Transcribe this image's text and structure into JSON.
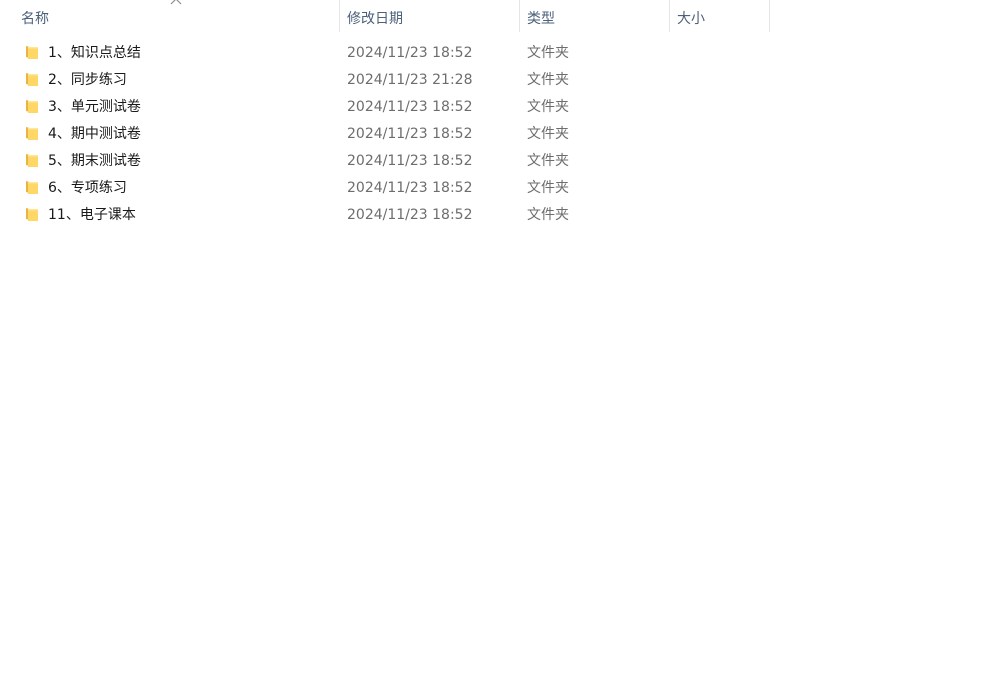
{
  "header": {
    "name_label": "名称",
    "date_label": "修改日期",
    "type_label": "类型",
    "size_label": "大小",
    "sort_icon": "chevron-up-icon"
  },
  "rows": [
    {
      "name": "1、知识点总结",
      "date": "2024/11/23 18:52",
      "type": "文件夹",
      "size": ""
    },
    {
      "name": "2、同步练习",
      "date": "2024/11/23 21:28",
      "type": "文件夹",
      "size": ""
    },
    {
      "name": "3、单元测试卷",
      "date": "2024/11/23 18:52",
      "type": "文件夹",
      "size": ""
    },
    {
      "name": "4、期中测试卷",
      "date": "2024/11/23 18:52",
      "type": "文件夹",
      "size": ""
    },
    {
      "name": "5、期末测试卷",
      "date": "2024/11/23 18:52",
      "type": "文件夹",
      "size": ""
    },
    {
      "name": "6、专项练习",
      "date": "2024/11/23 18:52",
      "type": "文件夹",
      "size": ""
    },
    {
      "name": "11、电子课本",
      "date": "2024/11/23 18:52",
      "type": "文件夹",
      "size": ""
    }
  ],
  "colors": {
    "header_text": "#4c607a",
    "name_text": "#1a1a1a",
    "meta_text": "#6d6d6d",
    "folder_front": "#ffd766",
    "folder_back": "#e8b443"
  }
}
